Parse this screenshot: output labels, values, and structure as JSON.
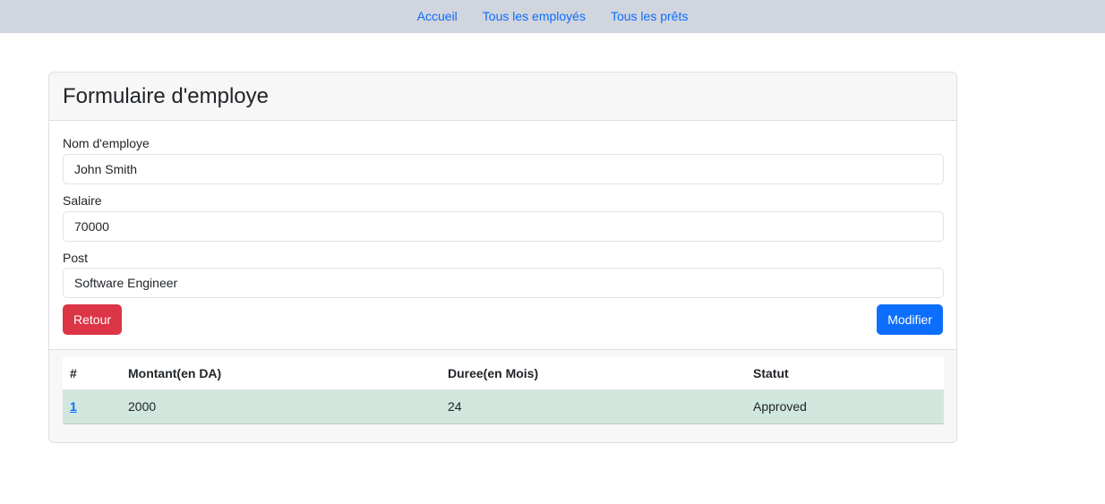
{
  "nav": {
    "items": [
      "Accueil",
      "Tous les employés",
      "Tous les prêts"
    ]
  },
  "card": {
    "title": "Formulaire d'employe"
  },
  "form": {
    "name_label": "Nom d'employe",
    "name_value": "John Smith",
    "salary_label": "Salaire",
    "salary_value": "70000",
    "post_label": "Post",
    "post_value": "Software Engineer",
    "back_label": "Retour",
    "edit_label": "Modifier"
  },
  "loans": {
    "headers": [
      "#",
      "Montant(en DA)",
      "Duree(en Mois)",
      "Statut"
    ],
    "rows": [
      {
        "id": "1",
        "amount": "2000",
        "duration": "24",
        "status": "Approved"
      }
    ]
  },
  "colors": {
    "nav_bg": "#d1d5de",
    "link": "#0d6efd",
    "danger": "#dc3545",
    "primary": "#0d6efd",
    "row_success": "#d1e7dd"
  }
}
